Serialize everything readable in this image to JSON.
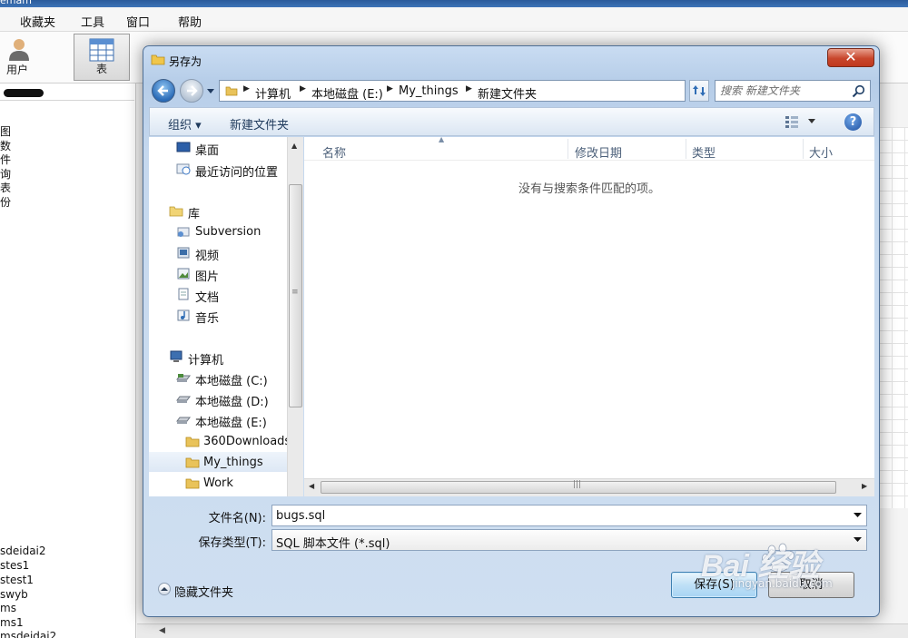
{
  "app": {
    "title_fragment": "emam",
    "menu": [
      "收藏夹",
      "工具",
      "窗口",
      "帮助"
    ],
    "toolbar": [
      {
        "label": "用户",
        "icon": "user-icon"
      },
      {
        "label": "表",
        "icon": "table-icon",
        "active": true
      }
    ],
    "sidebar_nav": [
      "图",
      "数",
      "件",
      "询",
      "表",
      "份"
    ],
    "sidebar_dbs": [
      "sdeidai2",
      "stes1",
      "stest1",
      "swyb",
      "ms",
      "ms1",
      "msdeidai2"
    ]
  },
  "dialog": {
    "title": "另存为",
    "close_label": "✕",
    "breadcrumb": [
      "计算机",
      "本地磁盘 (E:)",
      "My_things",
      "新建文件夹"
    ],
    "search_placeholder": "搜索 新建文件夹",
    "commands": {
      "organize": "组织 ▾",
      "new_folder": "新建文件夹"
    },
    "help_label": "?",
    "tree": {
      "favorites": [
        "桌面",
        "最近访问的位置"
      ],
      "library_title": "库",
      "libraries": [
        "Subversion",
        "视频",
        "图片",
        "文档",
        "音乐"
      ],
      "computer_title": "计算机",
      "drives": [
        "本地磁盘 (C:)",
        "本地磁盘 (D:)",
        "本地磁盘 (E:)"
      ],
      "folders": [
        "360Downloads",
        "My_things",
        "Work"
      ]
    },
    "columns": [
      "名称",
      "修改日期",
      "类型",
      "大小"
    ],
    "empty_message": "没有与搜索条件匹配的项。",
    "filename_label": "文件名(N):",
    "filename_value": "bugs.sql",
    "filetype_label": "保存类型(T):",
    "filetype_value": "SQL 脚本文件 (*.sql)",
    "hide_folders_label": "隐藏文件夹",
    "save_label": "保存(S)",
    "cancel_label": "取消"
  },
  "watermark": {
    "logo": "Bai 经验",
    "url": "jingyan.baidu.com"
  },
  "colors": {
    "title_bar": "#3d74b8",
    "close_button": "#c8462c",
    "save_button": "#bfe0f6",
    "link_text": "#1e395b"
  }
}
